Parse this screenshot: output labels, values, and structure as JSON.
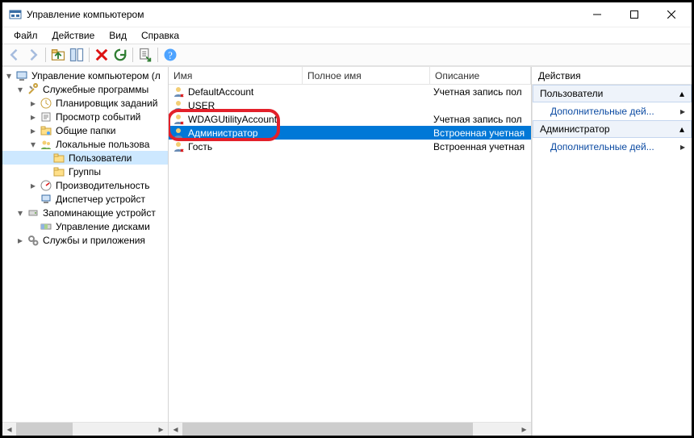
{
  "window": {
    "title": "Управление компьютером"
  },
  "menu": {
    "file": "Файл",
    "action": "Действие",
    "view": "Вид",
    "help": "Справка"
  },
  "tree": {
    "root": "Управление компьютером (л",
    "sys_tools": "Служебные программы",
    "task_scheduler": "Планировщик заданий",
    "event_viewer": "Просмотр событий",
    "shared_folders": "Общие папки",
    "local_users": "Локальные пользова",
    "users": "Пользователи",
    "groups": "Группы",
    "perf": "Производительность",
    "devmgr": "Диспетчер устройст",
    "storage": "Запоминающие устройст",
    "diskmgmt": "Управление дисками",
    "services": "Службы и приложения"
  },
  "columns": {
    "name": "Имя",
    "fullname": "Полное имя",
    "desc": "Описание"
  },
  "users": [
    {
      "name": "DefaultAccount",
      "full": "",
      "desc": "Учетная запись пол"
    },
    {
      "name": "USER",
      "full": "",
      "desc": ""
    },
    {
      "name": "WDAGUtilityAccount",
      "full": "",
      "desc": "Учетная запись пол"
    },
    {
      "name": "Администратор",
      "full": "",
      "desc": "Встроенная учетная"
    },
    {
      "name": "Гость",
      "full": "",
      "desc": "Встроенная учетная"
    }
  ],
  "actions": {
    "head": "Действия",
    "group1": "Пользователи",
    "more1": "Дополнительные дей...",
    "group2": "Администратор",
    "more2": "Дополнительные дей..."
  }
}
